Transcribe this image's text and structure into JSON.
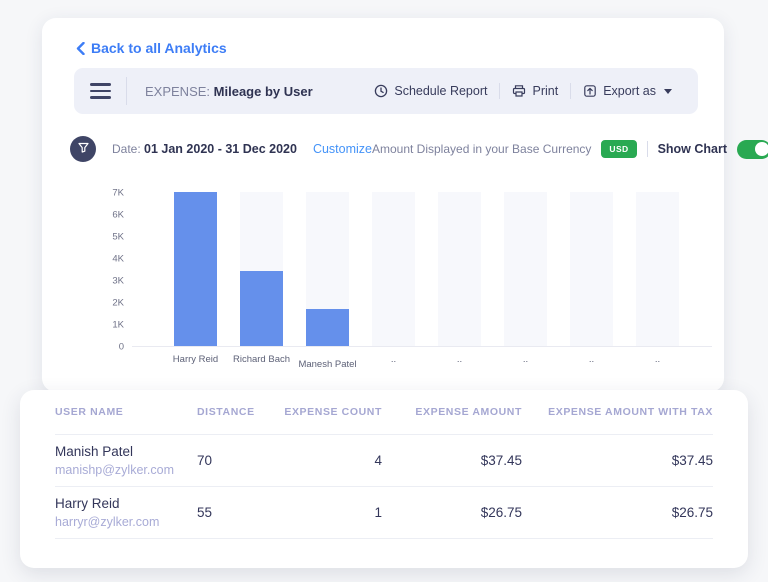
{
  "page": {
    "back_link": "Back to all Analytics"
  },
  "toolbar": {
    "report_type": "EXPENSE:",
    "report_name": "Mileage by User",
    "actions": [
      {
        "label": "Schedule Report",
        "icon": "clock-icon"
      },
      {
        "label": "Print",
        "icon": "printer-icon"
      },
      {
        "label": "Export as",
        "icon": "export-icon",
        "has_caret": true
      }
    ]
  },
  "filters": {
    "date_label": "Date:",
    "date_range": "01 Jan 2020 - 31 Dec 2020",
    "customize_label": "Customize",
    "currency_note": "Amount Displayed in your Base Currency",
    "currency_badge": "USD",
    "show_chart_label": "Show Chart",
    "show_chart_on": true
  },
  "chart_data": {
    "type": "bar",
    "title": "Mileage by User",
    "categories": [
      "Harry Reid",
      "Richard Bach",
      "Manesh Patel",
      "..",
      "..",
      "..",
      "..",
      ".."
    ],
    "values": [
      7000,
      3400,
      1700,
      null,
      null,
      null,
      null,
      null
    ],
    "ytick_labels": [
      "7K",
      "6K",
      "5K",
      "4K",
      "3K",
      "2K",
      "1K",
      "0"
    ],
    "ylim": [
      0,
      7000
    ],
    "xlabel": "",
    "ylabel": "",
    "grid": false,
    "legend": false,
    "bar_color": "#6590eb",
    "placeholder_color": "#f7f8fc"
  },
  "table": {
    "columns": [
      "USER NAME",
      "DISTANCE",
      "EXPENSE COUNT",
      "EXPENSE AMOUNT",
      "EXPENSE AMOUNT WITH TAX"
    ],
    "rows": [
      {
        "name": "Manish Patel",
        "email": "manishp@zylker.com",
        "distance": "70",
        "expense_count": "4",
        "expense_amount": "$37.45",
        "expense_amount_with_tax": "$37.45"
      },
      {
        "name": "Harry Reid",
        "email": "harryr@zylker.com",
        "distance": "55",
        "expense_count": "1",
        "expense_amount": "$26.75",
        "expense_amount_with_tax": "$26.75"
      }
    ]
  },
  "colors": {
    "accent_blue": "#3d7df6",
    "bar_blue": "#6590eb",
    "success_green": "#29a952",
    "toolbar_bg": "#eef0f8",
    "dark_navy": "#2f3352",
    "lavender_header": "#a5a7d2"
  }
}
